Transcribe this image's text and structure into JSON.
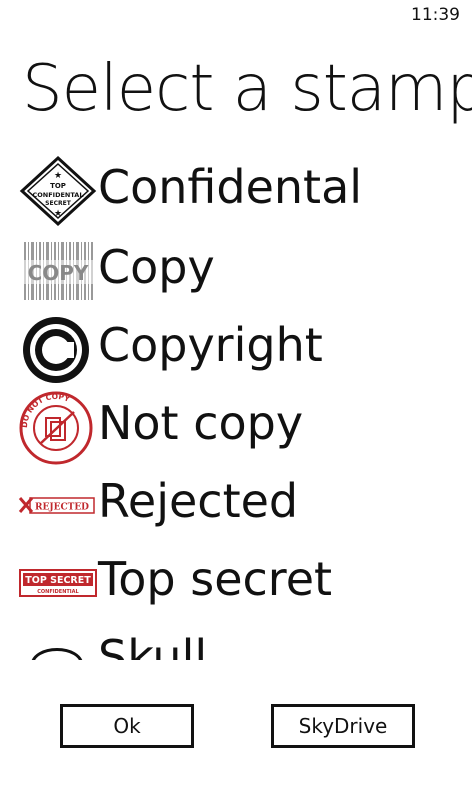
{
  "status": {
    "time": "11:39"
  },
  "title": "Select a stamp",
  "stamps": [
    {
      "label": "Confidental",
      "icon": "confidential-stamp-icon",
      "thumb_text": [
        "TOP",
        "CONFIDENTAL",
        "SECRET"
      ]
    },
    {
      "label": "Copy",
      "icon": "copy-barcode-stamp-icon",
      "thumb_text": [
        "COPY"
      ]
    },
    {
      "label": "Copyright",
      "icon": "copyright-symbol-icon",
      "thumb_text": []
    },
    {
      "label": "Not copy",
      "icon": "do-not-copy-stamp-icon",
      "thumb_text": [
        "DO NOT COPY"
      ]
    },
    {
      "label": "Rejected",
      "icon": "rejected-stamp-icon",
      "thumb_text": [
        "REJECTED"
      ]
    },
    {
      "label": "Top secret",
      "icon": "top-secret-stamp-icon",
      "thumb_text": [
        "TOP SECRET",
        "CONFIDENTIAL"
      ]
    },
    {
      "label": "Skull",
      "icon": "skull-icon",
      "thumb_text": []
    }
  ],
  "buttons": {
    "ok": "Ok",
    "skydrive": "SkyDrive"
  },
  "colors": {
    "stamp_red": "#c0282d",
    "text": "#111111",
    "background": "#ffffff"
  }
}
